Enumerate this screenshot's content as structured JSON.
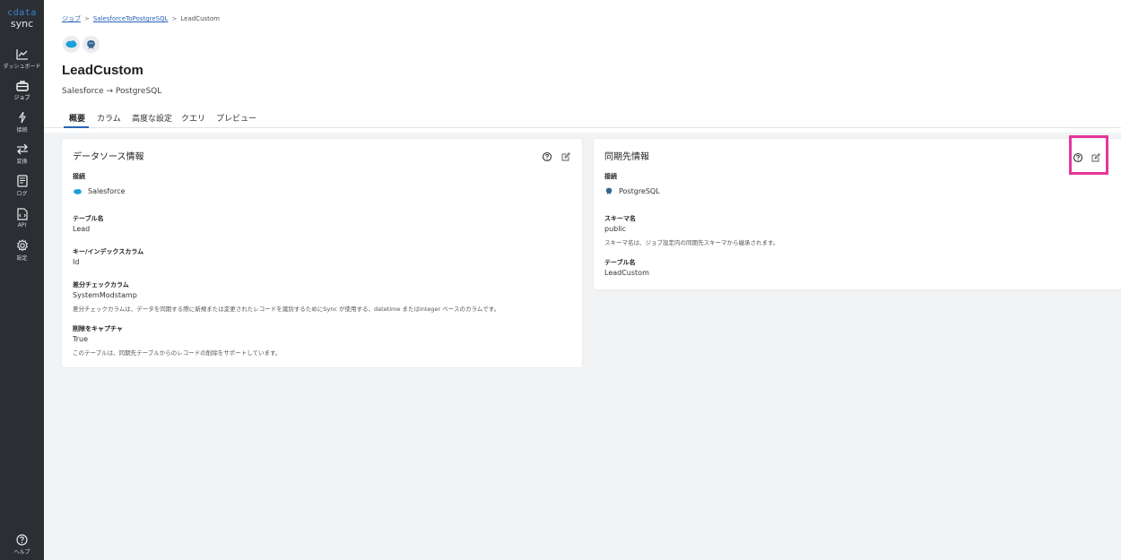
{
  "app": {
    "logo_top": "cdata",
    "logo_bottom": "sync"
  },
  "sidebar": {
    "items": [
      {
        "label": "ダッシュボード",
        "icon": "chart-line-icon"
      },
      {
        "label": "ジョブ",
        "icon": "briefcase-icon"
      },
      {
        "label": "接続",
        "icon": "plug-icon"
      },
      {
        "label": "変換",
        "icon": "arrows-icon"
      },
      {
        "label": "ログ",
        "icon": "log-icon"
      },
      {
        "label": "API",
        "icon": "api-icon"
      },
      {
        "label": "設定",
        "icon": "gear-icon"
      }
    ],
    "help_label": "ヘルプ"
  },
  "breadcrumb": {
    "root": "ジョブ",
    "parent": "SalesforceToPostgreSQL",
    "current": "LeadCustom",
    "separator": ">"
  },
  "header": {
    "title": "LeadCustom",
    "subtitle": "Salesforce → PostgreSQL",
    "source_icon": "salesforce-icon",
    "dest_icon": "postgresql-icon"
  },
  "tabs": [
    {
      "label": "概要",
      "active": true
    },
    {
      "label": "カラム",
      "active": false
    },
    {
      "label": "高度な設定",
      "active": false
    },
    {
      "label": "クエリ",
      "active": false
    },
    {
      "label": "プレビュー",
      "active": false
    }
  ],
  "source_card": {
    "title": "データソース情報",
    "connection_label": "接続",
    "connection_value": "Salesforce",
    "table_label": "テーブル名",
    "table_value": "Lead",
    "key_label": "キー/インデックスカラム",
    "key_value": "Id",
    "diff_label": "差分チェックカラム",
    "diff_value": "SystemModstamp",
    "diff_note": "差分チェックカラムは、データを同期する際に新規または変更されたレコードを識別するためにSync が使用する、datetime またはinteger ベースのカラムです。",
    "delete_label": "削除をキャプチャ",
    "delete_value": "True",
    "delete_note": "このテーブルは、同期先テーブルからのレコードの削除をサポートしています。"
  },
  "dest_card": {
    "title": "同期先情報",
    "connection_label": "接続",
    "connection_value": "PostgreSQL",
    "schema_label": "スキーマ名",
    "schema_value": "public",
    "schema_note": "スキーマ名は、ジョブ設定内の同期先スキーマから継承されます。",
    "table_label": "テーブル名",
    "table_value": "LeadCustom"
  },
  "colors": {
    "sidebar_bg": "#2b2f33",
    "accent": "#2a65b8",
    "highlight": "#e4369b",
    "salesforce": "#1ba0d8",
    "postgres": "#336791"
  }
}
